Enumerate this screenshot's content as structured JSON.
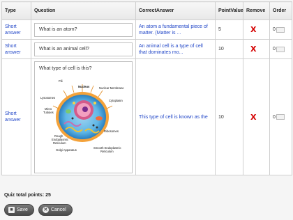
{
  "table": {
    "headers": {
      "type": "Type",
      "question": "Question",
      "answer": "CorrectAnswer",
      "points": "PointValue",
      "remove": "Remove",
      "order": "Order"
    },
    "rows": [
      {
        "type": "Short answer",
        "question": "What is an atom?",
        "answer": "An atom a fundamental piece of matter. (Matter is ...",
        "points": "5",
        "remove": "X",
        "order": "0"
      },
      {
        "type": "Short answer",
        "question": "What is an animal cell?",
        "answer": "An animal cell is a type of cell that dominates mo...",
        "points": "10",
        "remove": "X",
        "order": "0"
      },
      {
        "type": "Short answer",
        "question": "What type of cell is this?",
        "answer": "This type of cell is known as the",
        "points": "10",
        "remove": "X",
        "order": "0"
      }
    ],
    "cell_diagram_labels": {
      "pili": "Pili",
      "nucleus": "Nucleus",
      "nuclear_membrane": "Nuclear Membrane",
      "lysosomes": "Lysosomes",
      "cytoplasm": "Cytoplasm",
      "micro_tubules_1": "Micro",
      "micro_tubules_2": "Tubules",
      "ribosomes": "Ribosomes",
      "rough_er_1": "Rough",
      "rough_er_2": "Endoplasmic",
      "rough_er_3": "Reticulum",
      "golgi": "Golgi Apparatus",
      "smooth_er_1": "Smooth Endoplasmic",
      "smooth_er_2": "Reticulum"
    }
  },
  "footer": {
    "total_label": "Quiz total points: 25",
    "save_label": "Save",
    "cancel_label": "Cancel"
  },
  "colors": {
    "link_blue": "#2348c8",
    "remove_red": "#d40000"
  }
}
